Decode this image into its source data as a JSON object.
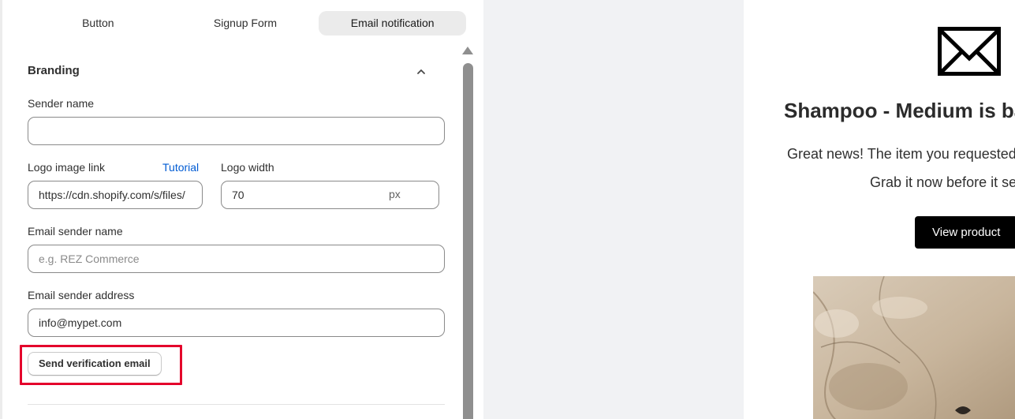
{
  "tabs": [
    {
      "label": "Button"
    },
    {
      "label": "Signup Form"
    },
    {
      "label": "Email notification"
    }
  ],
  "branding": {
    "title": "Branding",
    "sender_name": {
      "label": "Sender name",
      "value": ""
    },
    "logo_link": {
      "label": "Logo image link",
      "tutorial": "Tutorial",
      "value": "https://cdn.shopify.com/s/files/"
    },
    "logo_width": {
      "label": "Logo width",
      "value": "70",
      "suffix": "px"
    },
    "email_sender_name": {
      "label": "Email sender name",
      "placeholder": "e.g. REZ Commerce"
    },
    "email_sender_address": {
      "label": "Email sender address",
      "value": "info@mypet.com"
    },
    "verify_button": "Send verification email"
  },
  "preview": {
    "title": "Shampoo - Medium is back in stock",
    "line1": "Great news! The item you requested is back",
    "line2": "Grab it now before it sells out",
    "button": "View product"
  },
  "colors": {
    "link": "#005bd3",
    "highlight": "#e4002b",
    "preview_button": "#000000"
  }
}
